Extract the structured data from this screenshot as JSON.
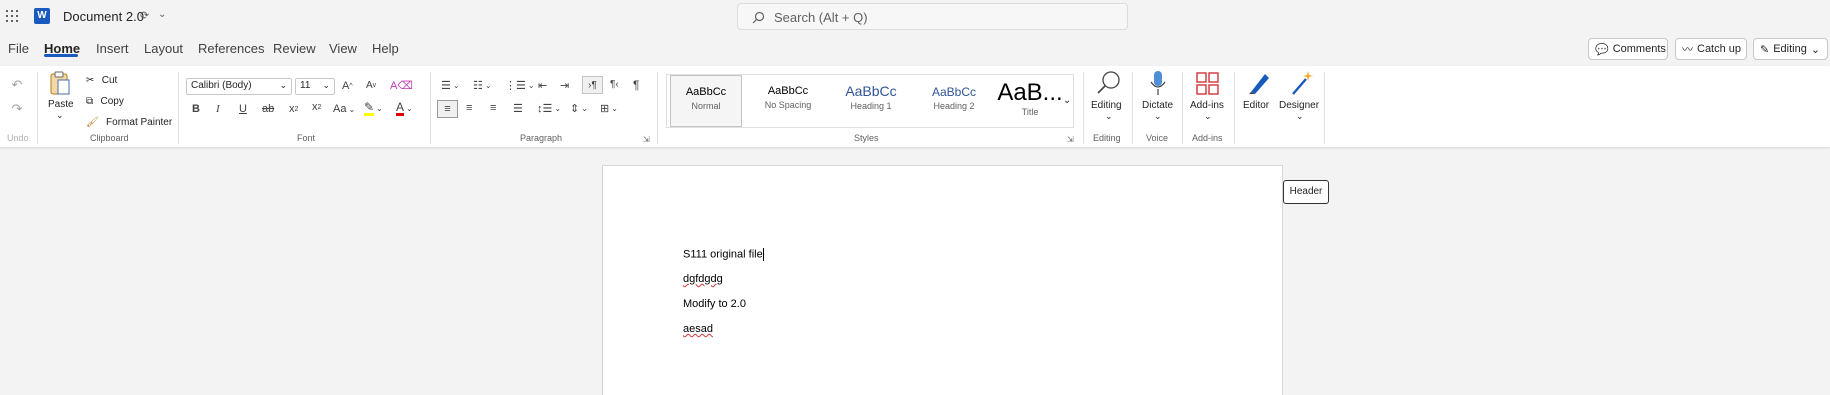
{
  "app": {
    "title": "Document 2.0"
  },
  "search": {
    "placeholder": "Search (Alt + Q)"
  },
  "tabs": [
    {
      "label": "File"
    },
    {
      "label": "Home"
    },
    {
      "label": "Insert"
    },
    {
      "label": "Layout"
    },
    {
      "label": "References"
    },
    {
      "label": "Review"
    },
    {
      "label": "View"
    },
    {
      "label": "Help"
    }
  ],
  "header_buttons": {
    "comments": "Comments",
    "catchup": "Catch up",
    "editing": "Editing"
  },
  "ribbon": {
    "undo_label": "Undo",
    "clipboard": {
      "paste": "Paste",
      "cut": "Cut",
      "copy": "Copy",
      "format_painter": "Format Painter",
      "group": "Clipboard"
    },
    "font": {
      "family": "Calibri (Body)",
      "size": "11",
      "group": "Font",
      "bold": "B",
      "italic": "I",
      "underline": "U",
      "strike": "ab",
      "sub": "x",
      "sup": "x",
      "case": "Aa",
      "grow": "A",
      "shrink": "A",
      "color_letter": "A"
    },
    "paragraph": {
      "group": "Paragraph"
    },
    "styles": {
      "group": "Styles",
      "items": [
        {
          "preview": "AaBbCc",
          "name": "Normal"
        },
        {
          "preview": "AaBbCc",
          "name": "No Spacing"
        },
        {
          "preview": "AaBbCc",
          "name": "Heading 1"
        },
        {
          "preview": "AaBbCc",
          "name": "Heading 2"
        },
        {
          "preview": "AaB...",
          "name": "Title"
        }
      ]
    },
    "editing": {
      "label": "Editing",
      "group": "Editing"
    },
    "voice": {
      "label": "Dictate",
      "group": "Voice"
    },
    "addins": {
      "label": "Add-ins",
      "group": "Add-ins"
    },
    "editor": {
      "label": "Editor"
    },
    "designer": {
      "label": "Designer"
    }
  },
  "document": {
    "lines": [
      "S111 original file",
      "dgfdgdg",
      "Modify to 2.0",
      "aesad"
    ]
  },
  "tooltip": {
    "header": "Header"
  },
  "colors": {
    "accent": "#185abd",
    "highlight": "#ffff00",
    "font_color": "#e00000"
  }
}
